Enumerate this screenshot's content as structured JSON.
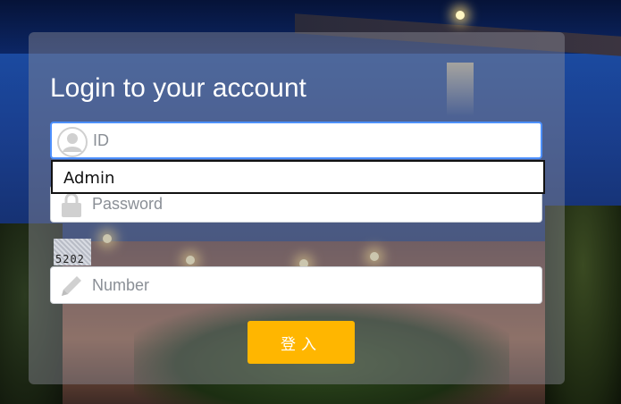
{
  "form": {
    "title": "Login to your account",
    "id_field": {
      "placeholder": "ID",
      "icon": "user-avatar-icon"
    },
    "autocomplete_suggestion": "Admin",
    "password_field": {
      "placeholder": "Password",
      "icon": "lock-icon"
    },
    "captcha_code": "5202",
    "number_field": {
      "placeholder": "Number",
      "icon": "pencil-icon"
    },
    "submit_label": "登入"
  },
  "colors": {
    "accent_button": "#ffb600",
    "focus_border": "#4d90fe"
  }
}
